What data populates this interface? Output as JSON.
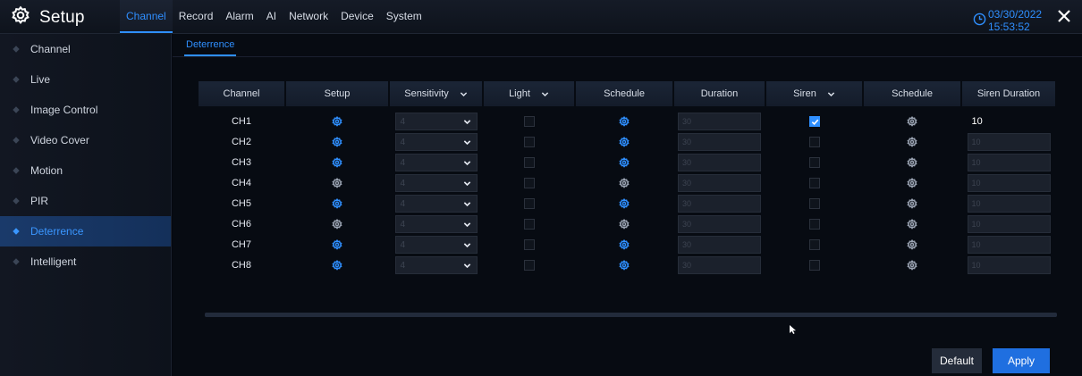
{
  "app": {
    "title": "Setup",
    "icon": "gear-icon"
  },
  "nav": {
    "tabs": [
      "Channel",
      "Record",
      "Alarm",
      "AI",
      "Network",
      "Device",
      "System"
    ],
    "active": "Channel"
  },
  "datetime": "03/30/2022 15:53:52",
  "sidebar": {
    "items": [
      {
        "label": "Channel",
        "active": false
      },
      {
        "label": "Live",
        "active": false
      },
      {
        "label": "Image Control",
        "active": false
      },
      {
        "label": "Video Cover",
        "active": false
      },
      {
        "label": "Motion",
        "active": false
      },
      {
        "label": "PIR",
        "active": false
      },
      {
        "label": "Deterrence",
        "active": true
      },
      {
        "label": "Intelligent",
        "active": false
      }
    ]
  },
  "subtab": {
    "label": "Deterrence"
  },
  "table": {
    "headers": {
      "channel": "Channel",
      "setup": "Setup",
      "sensitivity": "Sensitivity",
      "light": "Light",
      "schedule1": "Schedule",
      "duration": "Duration",
      "siren": "Siren",
      "schedule2": "Schedule",
      "siren_duration": "Siren Duration"
    },
    "rows": [
      {
        "channel": "CH1",
        "setup_active": true,
        "sensitivity": "4",
        "light": false,
        "schedule_active": true,
        "duration": "30",
        "siren": true,
        "siren_duration": "10",
        "siren_duration_enabled": true
      },
      {
        "channel": "CH2",
        "setup_active": true,
        "sensitivity": "4",
        "light": false,
        "schedule_active": true,
        "duration": "30",
        "siren": false,
        "siren_duration": "10",
        "siren_duration_enabled": false
      },
      {
        "channel": "CH3",
        "setup_active": true,
        "sensitivity": "4",
        "light": false,
        "schedule_active": true,
        "duration": "30",
        "siren": false,
        "siren_duration": "10",
        "siren_duration_enabled": false
      },
      {
        "channel": "CH4",
        "setup_active": false,
        "sensitivity": "4",
        "light": false,
        "schedule_active": false,
        "duration": "30",
        "siren": false,
        "siren_duration": "10",
        "siren_duration_enabled": false
      },
      {
        "channel": "CH5",
        "setup_active": true,
        "sensitivity": "4",
        "light": false,
        "schedule_active": true,
        "duration": "30",
        "siren": false,
        "siren_duration": "10",
        "siren_duration_enabled": false
      },
      {
        "channel": "CH6",
        "setup_active": false,
        "sensitivity": "4",
        "light": false,
        "schedule_active": false,
        "duration": "30",
        "siren": false,
        "siren_duration": "10",
        "siren_duration_enabled": false
      },
      {
        "channel": "CH7",
        "setup_active": true,
        "sensitivity": "4",
        "light": false,
        "schedule_active": true,
        "duration": "30",
        "siren": false,
        "siren_duration": "10",
        "siren_duration_enabled": false
      },
      {
        "channel": "CH8",
        "setup_active": true,
        "sensitivity": "4",
        "light": false,
        "schedule_active": true,
        "duration": "30",
        "siren": false,
        "siren_duration": "10",
        "siren_duration_enabled": false
      }
    ]
  },
  "buttons": {
    "default": "Default",
    "apply": "Apply"
  },
  "colors": {
    "accent": "#2f8fff",
    "inactive_gear": "#9aa3b2",
    "background": "#05080f"
  }
}
